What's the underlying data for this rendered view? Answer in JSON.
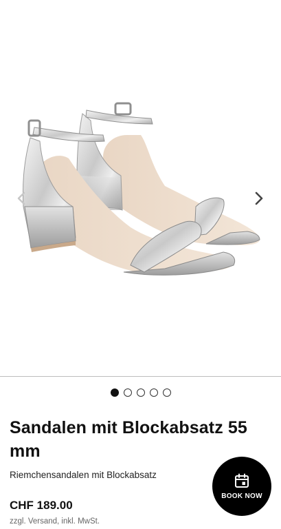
{
  "gallery": {
    "image_alt": "Silver metallic block heel sandals with ankle strap",
    "total_images": 5,
    "active_index": 0
  },
  "product": {
    "title": "Sandalen mit Blockabsatz 55 mm",
    "subtitle": "Riemchensandalen mit Blockabsatz",
    "price": "CHF 189.00",
    "tax_note": "zzgl. Versand, inkl. MwSt."
  },
  "cta": {
    "label": "BOOK NOW",
    "icon": "calendar-icon"
  },
  "icons": {
    "prev": "chevron-left-icon",
    "next": "chevron-right-icon"
  },
  "colors": {
    "cta_background": "#000000",
    "text_primary": "#111111",
    "text_secondary": "#666666"
  }
}
